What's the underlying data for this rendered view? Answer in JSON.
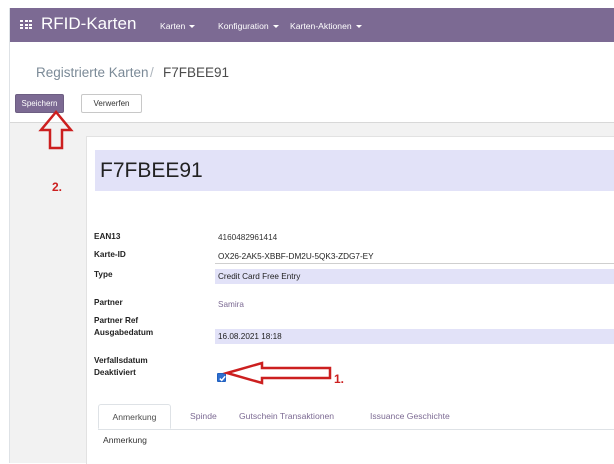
{
  "navbar": {
    "app_title": "RFID-Karten",
    "menus": [
      {
        "label": "Karten"
      },
      {
        "label": "Konfiguration"
      },
      {
        "label": "Karten-Aktionen"
      }
    ]
  },
  "breadcrumb": {
    "parent": "Registrierte Karten",
    "separator": "/",
    "current": "F7FBEE91"
  },
  "buttons": {
    "save": "Speichern",
    "discard": "Verwerfen"
  },
  "record": {
    "title": "F7FBEE91",
    "fields": {
      "ean13": {
        "label": "EAN13",
        "value": "4160482961414"
      },
      "karte_id": {
        "label": "Karte-ID",
        "value": "OX26-2AK5-XBBF-DM2U-5QK3-ZDG7-EY"
      },
      "type": {
        "label": "Type",
        "value": "Credit Card Free Entry"
      },
      "partner": {
        "label": "Partner",
        "value": "Samira"
      },
      "partner_ref": {
        "label": "Partner Ref",
        "value": ""
      },
      "ausgabedatum": {
        "label": "Ausgabedatum",
        "value": "16.08.2021 18:18"
      },
      "verfallsdatum": {
        "label": "Verfallsdatum",
        "value": ""
      },
      "deaktiviert": {
        "label": "Deaktiviert",
        "checked": true
      }
    }
  },
  "tabs": [
    {
      "label": "Anmerkung",
      "active": true
    },
    {
      "label": "Spinde",
      "active": false
    },
    {
      "label": "Gutschein Transaktionen",
      "active": false
    },
    {
      "label": "Issuance Geschichte",
      "active": false
    }
  ],
  "tab_content": {
    "label": "Anmerkung"
  },
  "annotations": {
    "step1": "1.",
    "step2": "2.",
    "color": "#cc1f1f"
  },
  "colors": {
    "brand": "#7c6a93",
    "field_highlight": "#e2e2f8",
    "checkbox": "#2f6fcf"
  }
}
